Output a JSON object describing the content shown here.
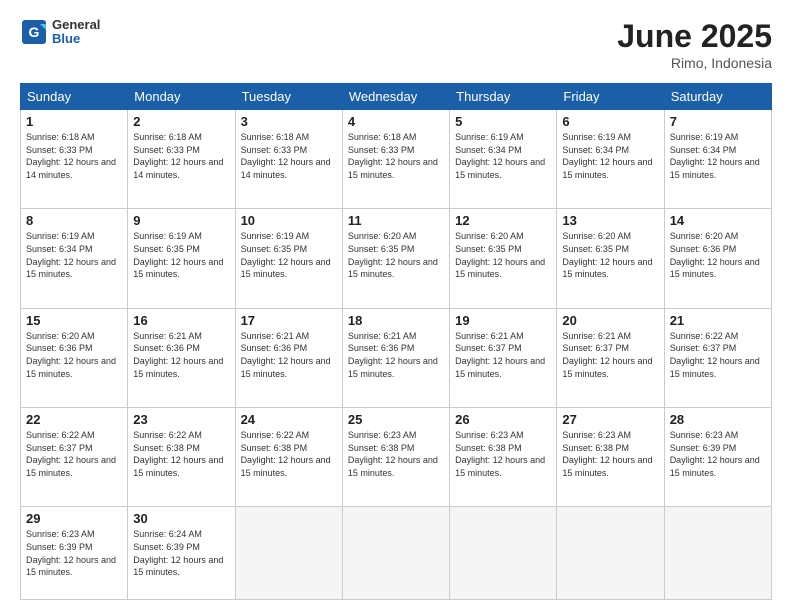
{
  "header": {
    "logo_general": "General",
    "logo_blue": "Blue",
    "title": "June 2025",
    "location": "Rimo, Indonesia"
  },
  "days_of_week": [
    "Sunday",
    "Monday",
    "Tuesday",
    "Wednesday",
    "Thursday",
    "Friday",
    "Saturday"
  ],
  "weeks": [
    [
      {
        "day": 1,
        "sunrise": "6:18 AM",
        "sunset": "6:33 PM",
        "daylight": "12 hours and 14 minutes."
      },
      {
        "day": 2,
        "sunrise": "6:18 AM",
        "sunset": "6:33 PM",
        "daylight": "12 hours and 14 minutes."
      },
      {
        "day": 3,
        "sunrise": "6:18 AM",
        "sunset": "6:33 PM",
        "daylight": "12 hours and 14 minutes."
      },
      {
        "day": 4,
        "sunrise": "6:18 AM",
        "sunset": "6:33 PM",
        "daylight": "12 hours and 15 minutes."
      },
      {
        "day": 5,
        "sunrise": "6:19 AM",
        "sunset": "6:34 PM",
        "daylight": "12 hours and 15 minutes."
      },
      {
        "day": 6,
        "sunrise": "6:19 AM",
        "sunset": "6:34 PM",
        "daylight": "12 hours and 15 minutes."
      },
      {
        "day": 7,
        "sunrise": "6:19 AM",
        "sunset": "6:34 PM",
        "daylight": "12 hours and 15 minutes."
      }
    ],
    [
      {
        "day": 8,
        "sunrise": "6:19 AM",
        "sunset": "6:34 PM",
        "daylight": "12 hours and 15 minutes."
      },
      {
        "day": 9,
        "sunrise": "6:19 AM",
        "sunset": "6:35 PM",
        "daylight": "12 hours and 15 minutes."
      },
      {
        "day": 10,
        "sunrise": "6:19 AM",
        "sunset": "6:35 PM",
        "daylight": "12 hours and 15 minutes."
      },
      {
        "day": 11,
        "sunrise": "6:20 AM",
        "sunset": "6:35 PM",
        "daylight": "12 hours and 15 minutes."
      },
      {
        "day": 12,
        "sunrise": "6:20 AM",
        "sunset": "6:35 PM",
        "daylight": "12 hours and 15 minutes."
      },
      {
        "day": 13,
        "sunrise": "6:20 AM",
        "sunset": "6:35 PM",
        "daylight": "12 hours and 15 minutes."
      },
      {
        "day": 14,
        "sunrise": "6:20 AM",
        "sunset": "6:36 PM",
        "daylight": "12 hours and 15 minutes."
      }
    ],
    [
      {
        "day": 15,
        "sunrise": "6:20 AM",
        "sunset": "6:36 PM",
        "daylight": "12 hours and 15 minutes."
      },
      {
        "day": 16,
        "sunrise": "6:21 AM",
        "sunset": "6:36 PM",
        "daylight": "12 hours and 15 minutes."
      },
      {
        "day": 17,
        "sunrise": "6:21 AM",
        "sunset": "6:36 PM",
        "daylight": "12 hours and 15 minutes."
      },
      {
        "day": 18,
        "sunrise": "6:21 AM",
        "sunset": "6:36 PM",
        "daylight": "12 hours and 15 minutes."
      },
      {
        "day": 19,
        "sunrise": "6:21 AM",
        "sunset": "6:37 PM",
        "daylight": "12 hours and 15 minutes."
      },
      {
        "day": 20,
        "sunrise": "6:21 AM",
        "sunset": "6:37 PM",
        "daylight": "12 hours and 15 minutes."
      },
      {
        "day": 21,
        "sunrise": "6:22 AM",
        "sunset": "6:37 PM",
        "daylight": "12 hours and 15 minutes."
      }
    ],
    [
      {
        "day": 22,
        "sunrise": "6:22 AM",
        "sunset": "6:37 PM",
        "daylight": "12 hours and 15 minutes."
      },
      {
        "day": 23,
        "sunrise": "6:22 AM",
        "sunset": "6:38 PM",
        "daylight": "12 hours and 15 minutes."
      },
      {
        "day": 24,
        "sunrise": "6:22 AM",
        "sunset": "6:38 PM",
        "daylight": "12 hours and 15 minutes."
      },
      {
        "day": 25,
        "sunrise": "6:23 AM",
        "sunset": "6:38 PM",
        "daylight": "12 hours and 15 minutes."
      },
      {
        "day": 26,
        "sunrise": "6:23 AM",
        "sunset": "6:38 PM",
        "daylight": "12 hours and 15 minutes."
      },
      {
        "day": 27,
        "sunrise": "6:23 AM",
        "sunset": "6:38 PM",
        "daylight": "12 hours and 15 minutes."
      },
      {
        "day": 28,
        "sunrise": "6:23 AM",
        "sunset": "6:39 PM",
        "daylight": "12 hours and 15 minutes."
      }
    ],
    [
      {
        "day": 29,
        "sunrise": "6:23 AM",
        "sunset": "6:39 PM",
        "daylight": "12 hours and 15 minutes."
      },
      {
        "day": 30,
        "sunrise": "6:24 AM",
        "sunset": "6:39 PM",
        "daylight": "12 hours and 15 minutes."
      },
      null,
      null,
      null,
      null,
      null
    ]
  ]
}
